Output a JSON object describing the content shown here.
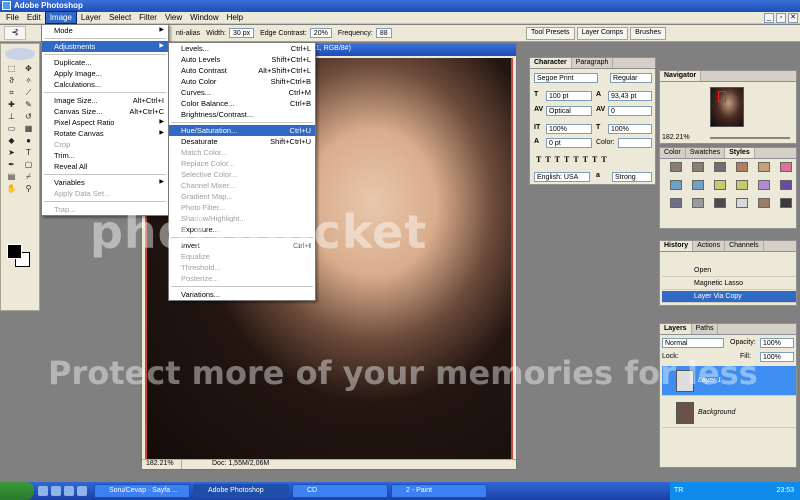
{
  "app": {
    "title": "Adobe Photoshop"
  },
  "menubar": [
    "File",
    "Edit",
    "Image",
    "Layer",
    "Select",
    "Filter",
    "View",
    "Window",
    "Help"
  ],
  "menubar_active": "Image",
  "options_bar": {
    "anti_alias": "nti-alias",
    "width_label": "Width:",
    "width_value": "30 px",
    "edge_label": "Edge Contrast:",
    "edge_value": "20%",
    "freq_label": "Frequency:",
    "freq_value": "88"
  },
  "palette_well": [
    "Tool Presets",
    "Layer Comps",
    "Brushes"
  ],
  "image_menu": [
    {
      "label": "Mode",
      "shortcut": "",
      "submenu": true
    },
    {
      "sep": true
    },
    {
      "label": "Adjustments",
      "shortcut": "",
      "submenu": true,
      "selected": true
    },
    {
      "sep": true
    },
    {
      "label": "Duplicate...",
      "shortcut": ""
    },
    {
      "label": "Apply Image...",
      "shortcut": ""
    },
    {
      "label": "Calculations...",
      "shortcut": ""
    },
    {
      "sep": true
    },
    {
      "label": "Image Size...",
      "shortcut": "Alt+Ctrl+I"
    },
    {
      "label": "Canvas Size...",
      "shortcut": "Alt+Ctrl+C"
    },
    {
      "label": "Pixel Aspect Ratio",
      "shortcut": "",
      "submenu": true
    },
    {
      "label": "Rotate Canvas",
      "shortcut": "",
      "submenu": true
    },
    {
      "label": "Crop",
      "shortcut": "",
      "disabled": true
    },
    {
      "label": "Trim...",
      "shortcut": ""
    },
    {
      "label": "Reveal All",
      "shortcut": ""
    },
    {
      "sep": true
    },
    {
      "label": "Variables",
      "shortcut": "",
      "submenu": true
    },
    {
      "label": "Apply Data Set...",
      "shortcut": "",
      "disabled": true
    },
    {
      "sep": true
    },
    {
      "label": "Trap...",
      "shortcut": "",
      "disabled": true
    }
  ],
  "adjust_menu": [
    {
      "label": "Levels...",
      "shortcut": "Ctrl+L"
    },
    {
      "label": "Auto Levels",
      "shortcut": "Shift+Ctrl+L"
    },
    {
      "label": "Auto Contrast",
      "shortcut": "Alt+Shift+Ctrl+L"
    },
    {
      "label": "Auto Color",
      "shortcut": "Shift+Ctrl+B"
    },
    {
      "label": "Curves...",
      "shortcut": "Ctrl+M"
    },
    {
      "label": "Color Balance...",
      "shortcut": "Ctrl+B"
    },
    {
      "label": "Brightness/Contrast...",
      "shortcut": ""
    },
    {
      "sep": true
    },
    {
      "label": "Hue/Saturation...",
      "shortcut": "Ctrl+U",
      "selected": true
    },
    {
      "label": "Desaturate",
      "shortcut": "Shift+Ctrl+U"
    },
    {
      "label": "Match Color...",
      "shortcut": "",
      "disabled": true
    },
    {
      "label": "Replace Color...",
      "shortcut": "",
      "disabled": true
    },
    {
      "label": "Selective Color...",
      "shortcut": "",
      "disabled": true
    },
    {
      "label": "Channel Mixer...",
      "shortcut": "",
      "disabled": true
    },
    {
      "label": "Gradient Map...",
      "shortcut": "",
      "disabled": true
    },
    {
      "label": "Photo Filter...",
      "shortcut": "",
      "disabled": true
    },
    {
      "label": "Shadow/Highlight...",
      "shortcut": "",
      "disabled": true
    },
    {
      "label": "Exposure...",
      "shortcut": ""
    },
    {
      "sep": true
    },
    {
      "label": "Invert",
      "shortcut": "Ctrl+I"
    },
    {
      "label": "Equalize",
      "shortcut": "",
      "disabled": true
    },
    {
      "label": "Threshold...",
      "shortcut": "",
      "disabled": true
    },
    {
      "label": "Posterize...",
      "shortcut": "",
      "disabled": true
    },
    {
      "sep": true
    },
    {
      "label": "Variations...",
      "shortcut": ""
    }
  ],
  "document": {
    "title": "t 1, RGB/8#)",
    "zoom": "182.21%",
    "doc_size": "Doc: 1,55M/2,06M"
  },
  "character_panel": {
    "tabs": [
      "Character",
      "Paragraph"
    ],
    "font": "Segoe Print",
    "style": "Regular",
    "size": "100 pt",
    "leading": "93,43 pt",
    "kerning": "Optical",
    "tracking": "0",
    "vscale": "100%",
    "hscale": "100%",
    "baseline": "0 pt",
    "color_label": "Color:",
    "language": "English: USA",
    "aa_label": "a",
    "antialias": "Strong"
  },
  "navigator": {
    "tab": "Navigator",
    "zoom": "182.21%"
  },
  "swatches_panel": {
    "tabs": [
      "Color",
      "Swatches",
      "Styles"
    ],
    "colors": [
      "#8a7e74",
      "#8a7e74",
      "#6f6f6f",
      "#b47e5e",
      "#c8a07a",
      "#e06fa0",
      "#6fa0c8",
      "#6fa0c8",
      "#c8c86f",
      "#c8c86f",
      "#b48cd0",
      "#6c4aa0",
      "#6f6f8a",
      "#9a9a9a",
      "#4a4a4a",
      "#d8d8d8",
      "#9a7e6a",
      "#3a3a3a"
    ]
  },
  "history_panel": {
    "tabs": [
      "History",
      "Actions",
      "Channels"
    ],
    "rows": [
      "Open",
      "Magnetic Lasso",
      "Layer Via Copy"
    ]
  },
  "layers_panel": {
    "tabs": [
      "Layers",
      "Paths"
    ],
    "blend": "Normal",
    "opacity_label": "Opacity:",
    "opacity": "100%",
    "lock_label": "Lock:",
    "fill_label": "Fill:",
    "fill": "100%",
    "layers": [
      "Layer 1",
      "Background"
    ]
  },
  "watermark": {
    "line1": "photobucket",
    "line2": "Protect more of your memories for less"
  },
  "taskbar": {
    "items": [
      "Soru/Cevap · Sayfa ...",
      "Adobe Photoshop",
      "CD",
      "2 - Paint"
    ],
    "language": "TR",
    "clock": "23:53"
  }
}
